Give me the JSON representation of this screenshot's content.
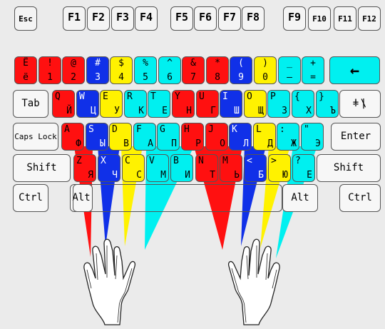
{
  "colors": {
    "red": "#ff1010",
    "blue": "#1030e8",
    "yellow": "#fff200",
    "cyan": "#00f0f0",
    "white": "#f6f6f6"
  },
  "function_keys": [
    "Esc",
    "F1",
    "F2",
    "F3",
    "F4",
    "F5",
    "F6",
    "F7",
    "F8",
    "F9",
    "F10",
    "F11",
    "F12"
  ],
  "rows": {
    "number": [
      {
        "top": "Ё",
        "bottom": "ё",
        "color": "red"
      },
      {
        "top": "!",
        "bottom": "1",
        "color": "red"
      },
      {
        "top": "@",
        "bottom": "2",
        "color": "red"
      },
      {
        "top": "#",
        "bottom": "3",
        "color": "blue"
      },
      {
        "top": "$",
        "bottom": "4",
        "color": "yellow"
      },
      {
        "top": "%",
        "bottom": "5",
        "color": "cyan"
      },
      {
        "top": "^",
        "bottom": "6",
        "color": "cyan"
      },
      {
        "top": "&",
        "bottom": "7",
        "color": "red"
      },
      {
        "top": "*",
        "bottom": "8",
        "color": "red"
      },
      {
        "top": "(",
        "bottom": "9",
        "color": "blue"
      },
      {
        "top": ")",
        "bottom": "0",
        "color": "yellow"
      },
      {
        "top": "_",
        "bottom": "–",
        "color": "cyan"
      },
      {
        "top": "+",
        "bottom": "=",
        "color": "cyan"
      }
    ],
    "top": [
      {
        "lat": "Q",
        "cyr": "Й",
        "color": "red"
      },
      {
        "lat": "W",
        "cyr": "Ц",
        "color": "blue"
      },
      {
        "lat": "E",
        "cyr": "У",
        "color": "yellow"
      },
      {
        "lat": "R",
        "cyr": "К",
        "color": "cyan"
      },
      {
        "lat": "T",
        "cyr": "Е",
        "color": "cyan"
      },
      {
        "lat": "Y",
        "cyr": "Н",
        "color": "red"
      },
      {
        "lat": "U",
        "cyr": "Г",
        "color": "red"
      },
      {
        "lat": "I",
        "cyr": "Ш",
        "color": "blue"
      },
      {
        "lat": "O",
        "cyr": "Щ",
        "color": "yellow"
      },
      {
        "lat": "P",
        "cyr": "З",
        "color": "cyan"
      },
      {
        "lat": "{",
        "cyr": "Х",
        "color": "cyan"
      },
      {
        "lat": "}",
        "cyr": "Ъ",
        "color": "cyan"
      }
    ],
    "home": [
      {
        "lat": "A",
        "cyr": "Ф",
        "color": "red"
      },
      {
        "lat": "S",
        "cyr": "Ы",
        "color": "blue"
      },
      {
        "lat": "D",
        "cyr": "В",
        "color": "yellow"
      },
      {
        "lat": "F",
        "cyr": "А",
        "color": "cyan"
      },
      {
        "lat": "G",
        "cyr": "П",
        "color": "cyan"
      },
      {
        "lat": "H",
        "cyr": "Р",
        "color": "red"
      },
      {
        "lat": "J",
        "cyr": "О",
        "color": "red"
      },
      {
        "lat": "K",
        "cyr": "Л",
        "color": "blue"
      },
      {
        "lat": "L",
        "cyr": "Д",
        "color": "yellow"
      },
      {
        "lat": ":",
        "cyr": "Ж",
        "color": "cyan"
      },
      {
        "lat": "\"",
        "cyr": "Э",
        "color": "cyan"
      }
    ],
    "bottom": [
      {
        "lat": "Z",
        "cyr": "Я",
        "color": "red"
      },
      {
        "lat": "X",
        "cyr": "Ч",
        "color": "blue"
      },
      {
        "lat": "C",
        "cyr": "С",
        "color": "yellow"
      },
      {
        "lat": "V",
        "cyr": "М",
        "color": "cyan"
      },
      {
        "lat": "B",
        "cyr": "И",
        "color": "cyan"
      },
      {
        "lat": "N",
        "cyr": "Т",
        "color": "red"
      },
      {
        "lat": "M",
        "cyr": "Ь",
        "color": "red"
      },
      {
        "lat": "<",
        "cyr": "Б",
        "color": "blue"
      },
      {
        "lat": ">",
        "cyr": "Ю",
        "color": "yellow"
      },
      {
        "lat": "?",
        "cyr": "Е",
        "color": "cyan"
      }
    ]
  },
  "backslash_key": {
    "top": "|",
    "bottom": "\\",
    "top2": "=",
    "bottom2": "!"
  },
  "modifiers": {
    "tab": "Tab",
    "caps": "Caps Lock",
    "enter": "Enter",
    "shift_left": "Shift",
    "shift_right": "Shift",
    "ctrl_left": "Ctrl",
    "ctrl_right": "Ctrl",
    "alt_left": "Alt",
    "alt_right": "Alt",
    "backspace": "←"
  }
}
